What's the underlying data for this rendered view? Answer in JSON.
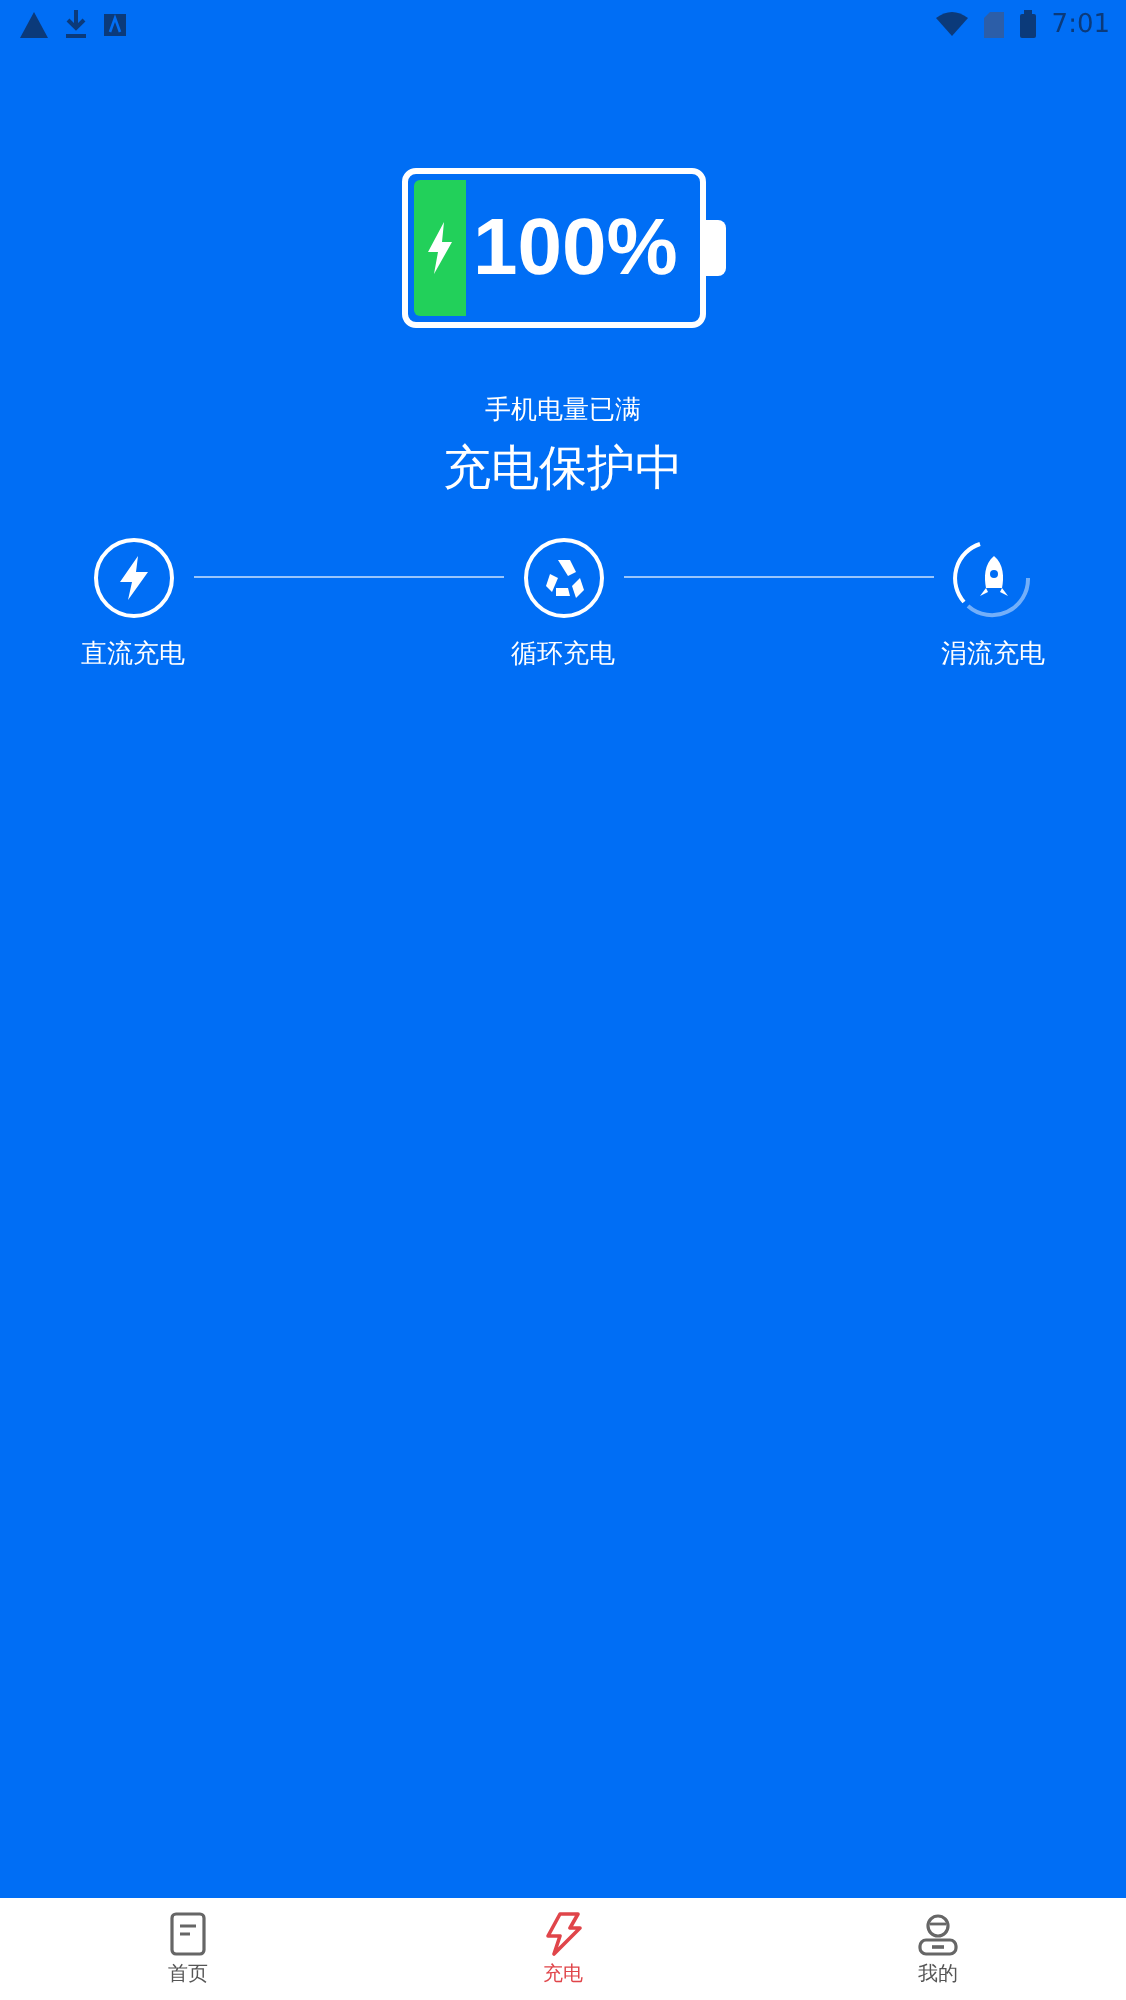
{
  "status_bar": {
    "time": "7:01"
  },
  "battery": {
    "percent": "100%",
    "charging": true
  },
  "status_text": "手机电量已满",
  "headline": "充电保护中",
  "stages": [
    {
      "kind": "bolt",
      "label": "直流充电",
      "active": false
    },
    {
      "kind": "recycle",
      "label": "循环充电",
      "active": false
    },
    {
      "kind": "rocket",
      "label": "涓流充电",
      "active": true
    }
  ],
  "tabs": [
    {
      "kind": "home",
      "label": "首页",
      "selected": false
    },
    {
      "kind": "charge",
      "label": "充电",
      "selected": true
    },
    {
      "kind": "profile",
      "label": "我的",
      "selected": false
    }
  ]
}
